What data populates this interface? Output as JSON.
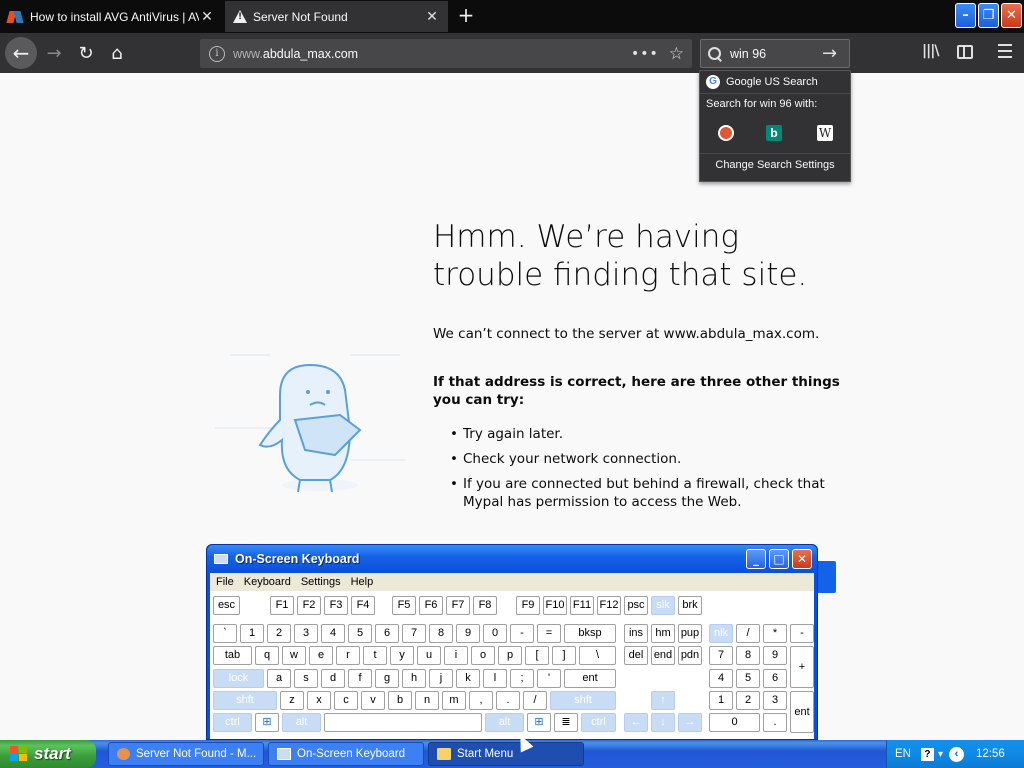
{
  "browser": {
    "tabs": [
      {
        "title": "How to install AVG AntiVirus | AVG",
        "icon": "avg-favicon",
        "active": false
      },
      {
        "title": "Server Not Found",
        "icon": "warning-icon",
        "active": true
      }
    ],
    "new_tab": "+",
    "window_controls": {
      "minimize": "–",
      "restore": "❐",
      "close": "✕"
    },
    "nav": {
      "back": "←",
      "forward": "→",
      "reload": "↻",
      "home": "⌂"
    },
    "url": {
      "prefix": "www.",
      "domain": "abdula_max.com"
    },
    "page_actions": "•••",
    "bookmark": "☆",
    "search": {
      "value": "win 96",
      "go": "→"
    },
    "library": "|||\\"
  },
  "search_popup": {
    "google_label": "Google US Search",
    "search_for": "Search for win 96 with:",
    "engines": [
      "duckduckgo-icon",
      "bing-icon",
      "wikipedia-icon"
    ],
    "bing_glyph": "b",
    "wiki_glyph": "W",
    "google_glyph": "G",
    "settings": "Change Search Settings"
  },
  "error_page": {
    "title": "Hmm. We’re having trouble finding that site.",
    "description": "We can’t connect to the server at www.abdula_max.com.",
    "subheading": "If that address is correct, here are three other things you can try:",
    "suggestions": [
      "Try again later.",
      "Check your network connection.",
      "If you are connected but behind a firewall, check that Mypal has permission to access the Web."
    ]
  },
  "osk": {
    "title": "On-Screen Keyboard",
    "menu": [
      "File",
      "Keyboard",
      "Settings",
      "Help"
    ],
    "rows": {
      "r1": [
        "esc",
        "F1",
        "F2",
        "F3",
        "F4",
        "F5",
        "F6",
        "F7",
        "F8",
        "F9",
        "F10",
        "F11",
        "F12",
        "psc",
        "slk",
        "brk"
      ],
      "r2": [
        "`",
        "1",
        "2",
        "3",
        "4",
        "5",
        "6",
        "7",
        "8",
        "9",
        "0",
        "-",
        "=",
        "bksp",
        "ins",
        "hm",
        "pup",
        "nlk",
        "/",
        "*",
        "-"
      ],
      "r3": [
        "tab",
        "q",
        "w",
        "e",
        "r",
        "t",
        "y",
        "u",
        "i",
        "o",
        "p",
        "[",
        "]",
        "\\",
        "del",
        "end",
        "pdn",
        "7",
        "8",
        "9",
        "+"
      ],
      "r4": [
        "lock",
        "a",
        "s",
        "d",
        "f",
        "g",
        "h",
        "j",
        "k",
        "l",
        ";",
        "'",
        "ent",
        "4",
        "5",
        "6"
      ],
      "r5": [
        "shft",
        "z",
        "x",
        "c",
        "v",
        "b",
        "n",
        "m",
        ",",
        ".",
        "/",
        "shft",
        "↑",
        "1",
        "2",
        "3",
        "ent"
      ],
      "r6": [
        "ctrl",
        "alt",
        "alt",
        "ctrl",
        "←",
        "↓",
        "→",
        "0",
        "."
      ]
    }
  },
  "taskbar": {
    "start": "start",
    "tasks": [
      "Server Not Found - M...",
      "On-Screen Keyboard",
      "Start Menu"
    ],
    "lang": "EN",
    "help": "?",
    "clock": "12:56"
  }
}
